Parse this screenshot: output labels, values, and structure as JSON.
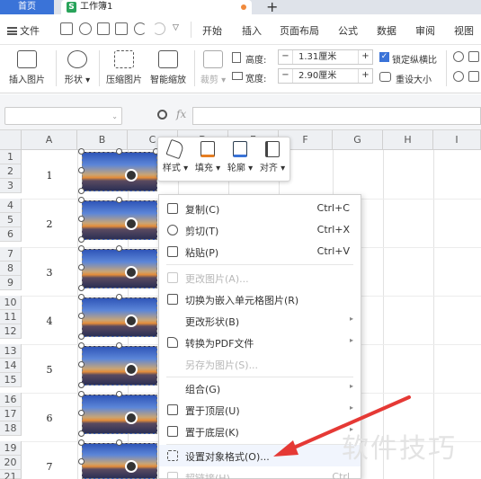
{
  "titlebar": {
    "home_tab": "首页",
    "doc_tab": "工作簿1",
    "doc_icon": "S"
  },
  "menubar": {
    "file": "文件",
    "items": [
      "开始",
      "插入",
      "页面布局",
      "公式",
      "数据",
      "审阅",
      "视图"
    ]
  },
  "ribbon": {
    "insert_picture": "插入图片",
    "shape": "形状",
    "compress": "压缩图片",
    "smart_zoom": "智能缩放",
    "crop": "裁剪",
    "height_label": "高度:",
    "height_value": "1.31厘米",
    "width_label": "宽度:",
    "width_value": "2.90厘米",
    "lock_ratio": "锁定纵横比",
    "reset_size": "重设大小"
  },
  "formula": {
    "fx": "fx"
  },
  "sheet": {
    "columns": [
      "A",
      "B",
      "C",
      "D",
      "E",
      "F",
      "G",
      "H",
      "I"
    ],
    "rows": [
      "1",
      "2",
      "3",
      "4",
      "5",
      "6",
      "7",
      "8",
      "9",
      "10",
      "11",
      "12",
      "13",
      "14",
      "15",
      "16",
      "17",
      "18",
      "19",
      "20",
      "21"
    ],
    "cell_values": [
      "1",
      "2",
      "3",
      "4",
      "5",
      "6",
      "7"
    ]
  },
  "mini_toolbar": {
    "style": "样式",
    "fill": "填充",
    "outline": "轮廓",
    "align": "对齐"
  },
  "context_menu": {
    "copy": "复制(C)",
    "copy_sc": "Ctrl+C",
    "cut": "剪切(T)",
    "cut_sc": "Ctrl+X",
    "paste": "粘贴(P)",
    "paste_sc": "Ctrl+V",
    "change_picture": "更改图片(A)...",
    "embed_in_cell": "切换为嵌入单元格图片(R)",
    "change_shape": "更改形状(B)",
    "to_pdf": "转换为PDF文件",
    "save_as_picture": "另存为图片(S)...",
    "group": "组合(G)",
    "bring_front": "置于顶层(U)",
    "send_back": "置于底层(K)",
    "format_object": "设置对象格式(O)...",
    "hyperlink": "超链接(H)...",
    "hyperlink_sc": "Ctrl"
  },
  "watermark": "软件技巧",
  "colors": {
    "accent": "#3a73d8",
    "arrow": "#e53935",
    "sheet_icon": "#29a35a"
  }
}
